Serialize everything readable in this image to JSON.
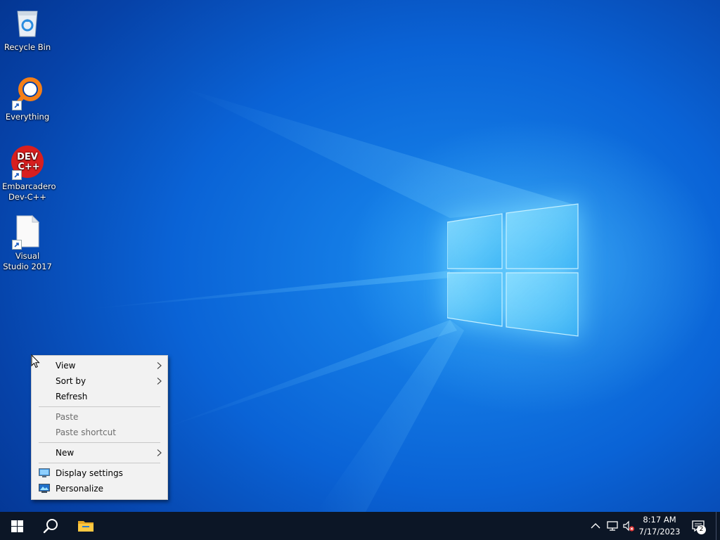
{
  "desktop": {
    "icons": [
      {
        "label": "Recycle Bin",
        "icon": "recycle-bin-icon"
      },
      {
        "label": "Everything",
        "icon": "everything-search-icon"
      },
      {
        "label": "Embarcadero Dev-C++",
        "icon": "dev-cpp-icon",
        "badge_line1": "DEV",
        "badge_line2": "C++"
      },
      {
        "label": "Visual Studio 2017",
        "icon": "blank-file-icon"
      }
    ]
  },
  "context_menu": {
    "view": "View",
    "sort_by": "Sort by",
    "refresh": "Refresh",
    "paste": "Paste",
    "paste_shortcut": "Paste shortcut",
    "new": "New",
    "display_settings": "Display settings",
    "personalize": "Personalize"
  },
  "taskbar": {
    "start": "windows-start-icon",
    "search": "search-icon",
    "file_explorer": "file-explorer-icon",
    "tray": {
      "chevron": "chevron-up-icon",
      "network": "network-icon",
      "volume": "volume-muted-icon",
      "time": "8:17 AM",
      "date": "7/17/2023",
      "notifications_count": "2"
    }
  },
  "colors": {
    "accent": "#0a63d6",
    "taskbar": "#0c1626",
    "menu_bg": "#f2f2f2",
    "disabled_text": "#6d6d6d"
  }
}
